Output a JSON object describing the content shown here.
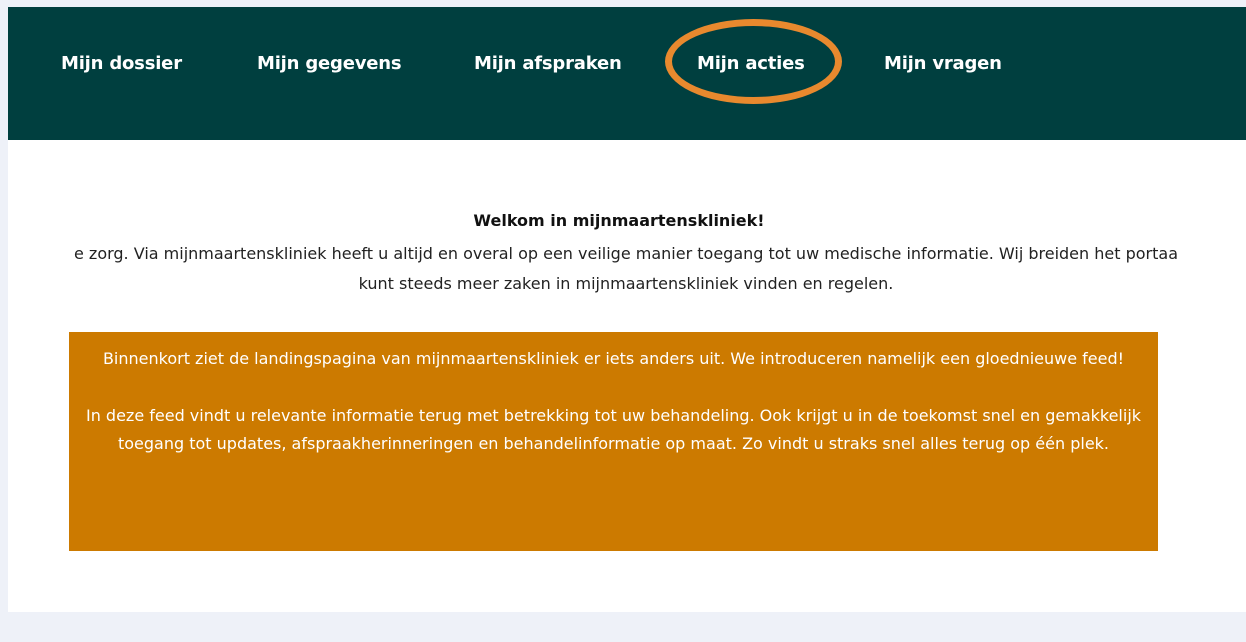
{
  "nav": {
    "items": [
      {
        "label": "Mijn dossier"
      },
      {
        "label": "Mijn gegevens"
      },
      {
        "label": "Mijn afspraken"
      },
      {
        "label": "Mijn acties"
      },
      {
        "label": "Mijn vragen"
      }
    ],
    "highlighted": "Mijn acties"
  },
  "welcome": {
    "title": "Welkom in mijnmaartenskliniek!",
    "intro_line1": "e zorg. Via mijnmaartenskliniek heeft u altijd en overal op een veilige manier toegang tot uw medische informatie. Wij breiden het portaa",
    "intro_line2": "kunt steeds meer zaken in mijnmaartenskliniek vinden en regelen."
  },
  "notice": {
    "paragraph1": "Binnenkort ziet de landingspagina van mijnmaartenskliniek er iets anders uit. We introduceren namelijk een gloednieuwe feed!",
    "paragraph2": "In deze feed vindt u relevante informatie terug met betrekking tot uw behandeling. Ook krijgt u in de toekomst snel en gemakkelijk toegang tot updates, afspraakherinneringen en behandelinformatie op maat. Zo vindt u straks snel alles terug op één plek."
  },
  "colors": {
    "navbar": "#003f3f",
    "highlight_ring": "#e8892e",
    "notice_background": "#cc7a00",
    "page_background": "#eef1f8"
  }
}
